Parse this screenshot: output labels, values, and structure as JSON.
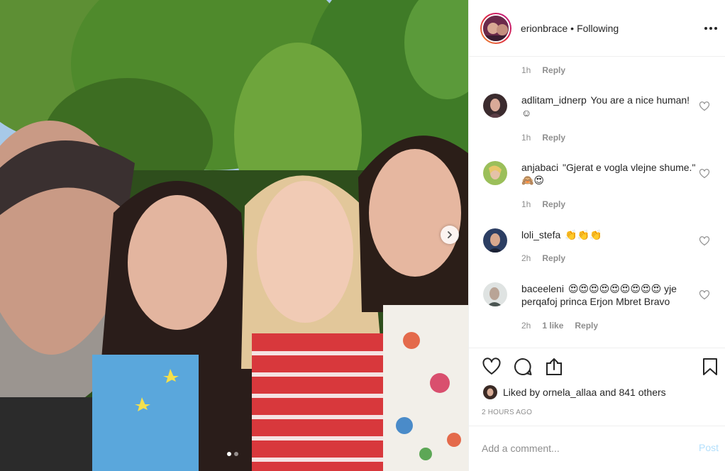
{
  "header": {
    "username": "erionbrace",
    "separator": "•",
    "follow_status": "Following"
  },
  "comments": {
    "top_meta": {
      "time": "1h",
      "reply_label": "Reply"
    },
    "items": [
      {
        "user": "adlitam_idnerp",
        "text": "You are a nice human! ☺",
        "time": "1h",
        "reply_label": "Reply"
      },
      {
        "user": "anjabaci",
        "text": "\"Gjerat e vogla vlejne shume.\" 🙈😍",
        "time": "1h",
        "reply_label": "Reply"
      },
      {
        "user": "loli_stefa",
        "text": "👏👏👏",
        "time": "2h",
        "reply_label": "Reply"
      },
      {
        "user": "baceeleni",
        "text": "😍😍😍😍😍😍😍😍😍 yje perqafoj princa Erjon Mbret Bravo",
        "time": "2h",
        "likes": "1 like",
        "reply_label": "Reply"
      }
    ]
  },
  "actions": {
    "liked_by_prefix": "Liked by",
    "liked_by_user": "ornela_allaa",
    "liked_by_suffix": "and 841 others",
    "time_ago": "2 HOURS AGO"
  },
  "add_comment": {
    "placeholder": "Add a comment...",
    "post_label": "Post"
  },
  "colors": {
    "post_disabled": "#b2dffc",
    "muted_text": "#8e8e8e",
    "primary_text": "#262626",
    "divider": "#efefef"
  },
  "icons": {
    "more": "more-options-icon",
    "like": "heart-icon",
    "comment": "comment-bubble-icon",
    "share": "share-icon",
    "save": "bookmark-icon",
    "carousel_next": "chevron-right-icon"
  },
  "carousel": {
    "current_slide": 1,
    "total_slides": 2
  }
}
